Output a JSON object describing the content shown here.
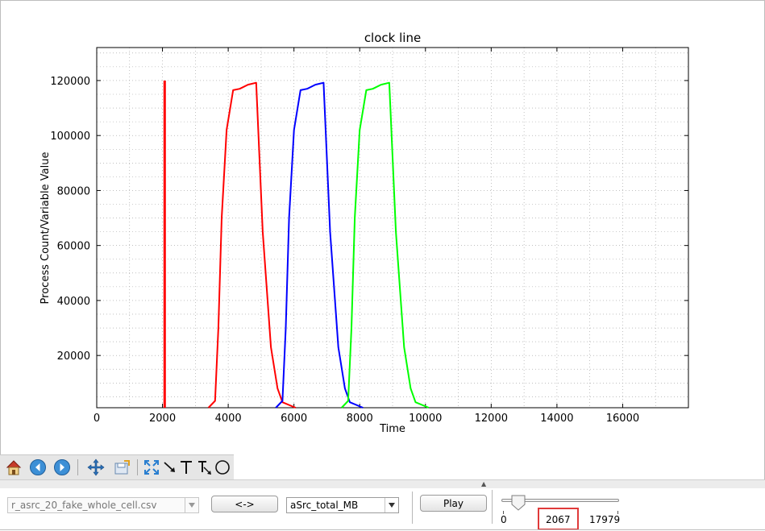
{
  "chart_data": {
    "type": "line",
    "title": "clock line",
    "xlabel": "Time",
    "ylabel": "Process Count/Variable Value",
    "xlim": [
      0,
      18000
    ],
    "ylim": [
      1000,
      132000
    ],
    "x_ticks": [
      0,
      2000,
      4000,
      6000,
      8000,
      10000,
      12000,
      14000,
      16000
    ],
    "y_ticks": [
      20000,
      40000,
      60000,
      80000,
      100000,
      120000
    ],
    "grid": true,
    "series": [
      {
        "color": "#ff0000",
        "points": [
          [
            3400,
            1000
          ],
          [
            3600,
            3500
          ],
          [
            3700,
            30000
          ],
          [
            3800,
            70000
          ],
          [
            3950,
            102000
          ],
          [
            4150,
            116500
          ],
          [
            4350,
            117000
          ],
          [
            4600,
            118500
          ],
          [
            4850,
            119200
          ],
          [
            5050,
            65000
          ],
          [
            5300,
            23000
          ],
          [
            5500,
            8000
          ],
          [
            5650,
            3000
          ],
          [
            6050,
            1000
          ]
        ]
      },
      {
        "color": "#0000ff",
        "points": [
          [
            5450,
            1000
          ],
          [
            5650,
            3500
          ],
          [
            5750,
            30000
          ],
          [
            5850,
            70000
          ],
          [
            6000,
            102000
          ],
          [
            6200,
            116500
          ],
          [
            6400,
            117000
          ],
          [
            6650,
            118500
          ],
          [
            6900,
            119200
          ],
          [
            7100,
            65000
          ],
          [
            7350,
            23000
          ],
          [
            7550,
            8000
          ],
          [
            7700,
            3000
          ],
          [
            8100,
            1000
          ]
        ]
      },
      {
        "color": "#00ff00",
        "points": [
          [
            7450,
            1000
          ],
          [
            7650,
            3500
          ],
          [
            7750,
            30000
          ],
          [
            7850,
            70000
          ],
          [
            8000,
            102000
          ],
          [
            8200,
            116500
          ],
          [
            8400,
            117000
          ],
          [
            8650,
            118500
          ],
          [
            8900,
            119200
          ],
          [
            9100,
            65000
          ],
          [
            9350,
            23000
          ],
          [
            9550,
            8000
          ],
          [
            9700,
            3000
          ],
          [
            10100,
            1000
          ]
        ]
      }
    ],
    "clock_line": {
      "x": 2067,
      "y_top": 120000,
      "color": "#ff0000"
    }
  },
  "toolbar": {
    "tools": [
      "home-icon",
      "back-icon",
      "forward-icon",
      "pan-icon",
      "save-icon",
      "fit-icon",
      "arrow-icon",
      "text-icon",
      "text-arrow-icon",
      "circle-icon"
    ]
  },
  "controls": {
    "file_combo": "r_asrc_20_fake_whole_cell.csv",
    "swap_button": "<->",
    "variable_combo": "aSrc_total_MB",
    "play_button": "Play",
    "slider_min": "0",
    "slider_current": "2067",
    "slider_max": "17979",
    "slider_fraction": 0.115
  },
  "colors": {
    "accent_box": "#e03a3a"
  }
}
